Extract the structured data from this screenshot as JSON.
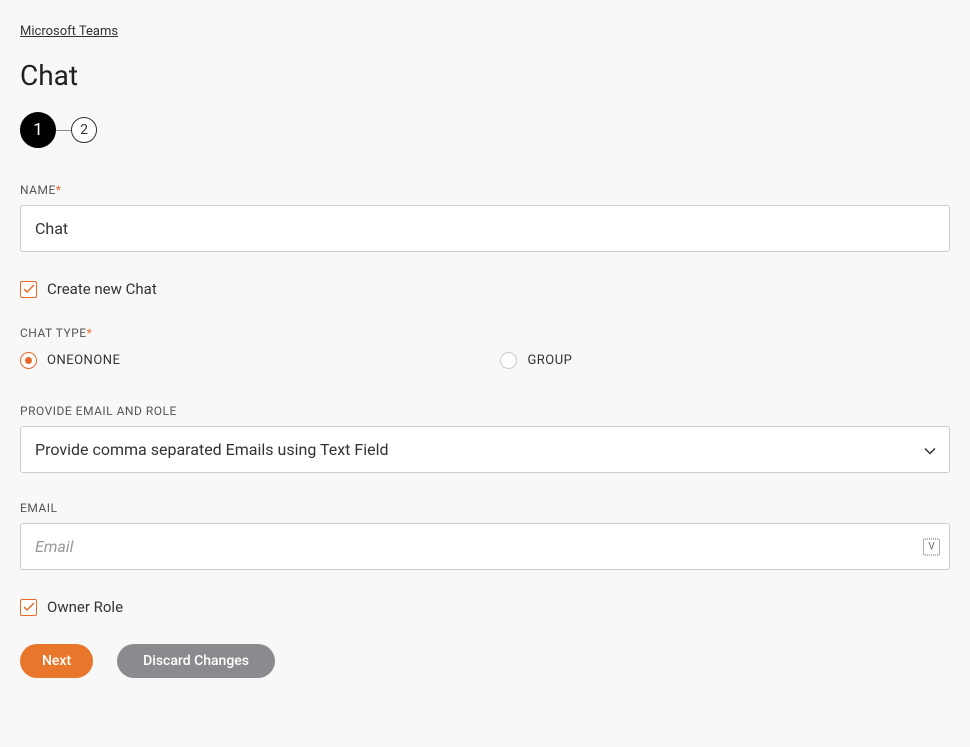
{
  "breadcrumb": "Microsoft Teams",
  "page_title": "Chat",
  "stepper": {
    "step1": "1",
    "step2": "2"
  },
  "name_field": {
    "label": "NAME",
    "value": "Chat"
  },
  "create_new": {
    "label": "Create new Chat",
    "checked": true
  },
  "chat_type": {
    "label": "CHAT TYPE",
    "options": {
      "oneonone": "ONEONONE",
      "group": "GROUP"
    },
    "selected": "oneonone"
  },
  "email_role": {
    "label": "PROVIDE EMAIL AND ROLE",
    "selected": "Provide comma separated Emails using Text Field"
  },
  "email_field": {
    "label": "EMAIL",
    "placeholder": "Email",
    "value": ""
  },
  "owner_role": {
    "label": "Owner Role",
    "checked": true
  },
  "buttons": {
    "next": "Next",
    "discard": "Discard Changes"
  }
}
